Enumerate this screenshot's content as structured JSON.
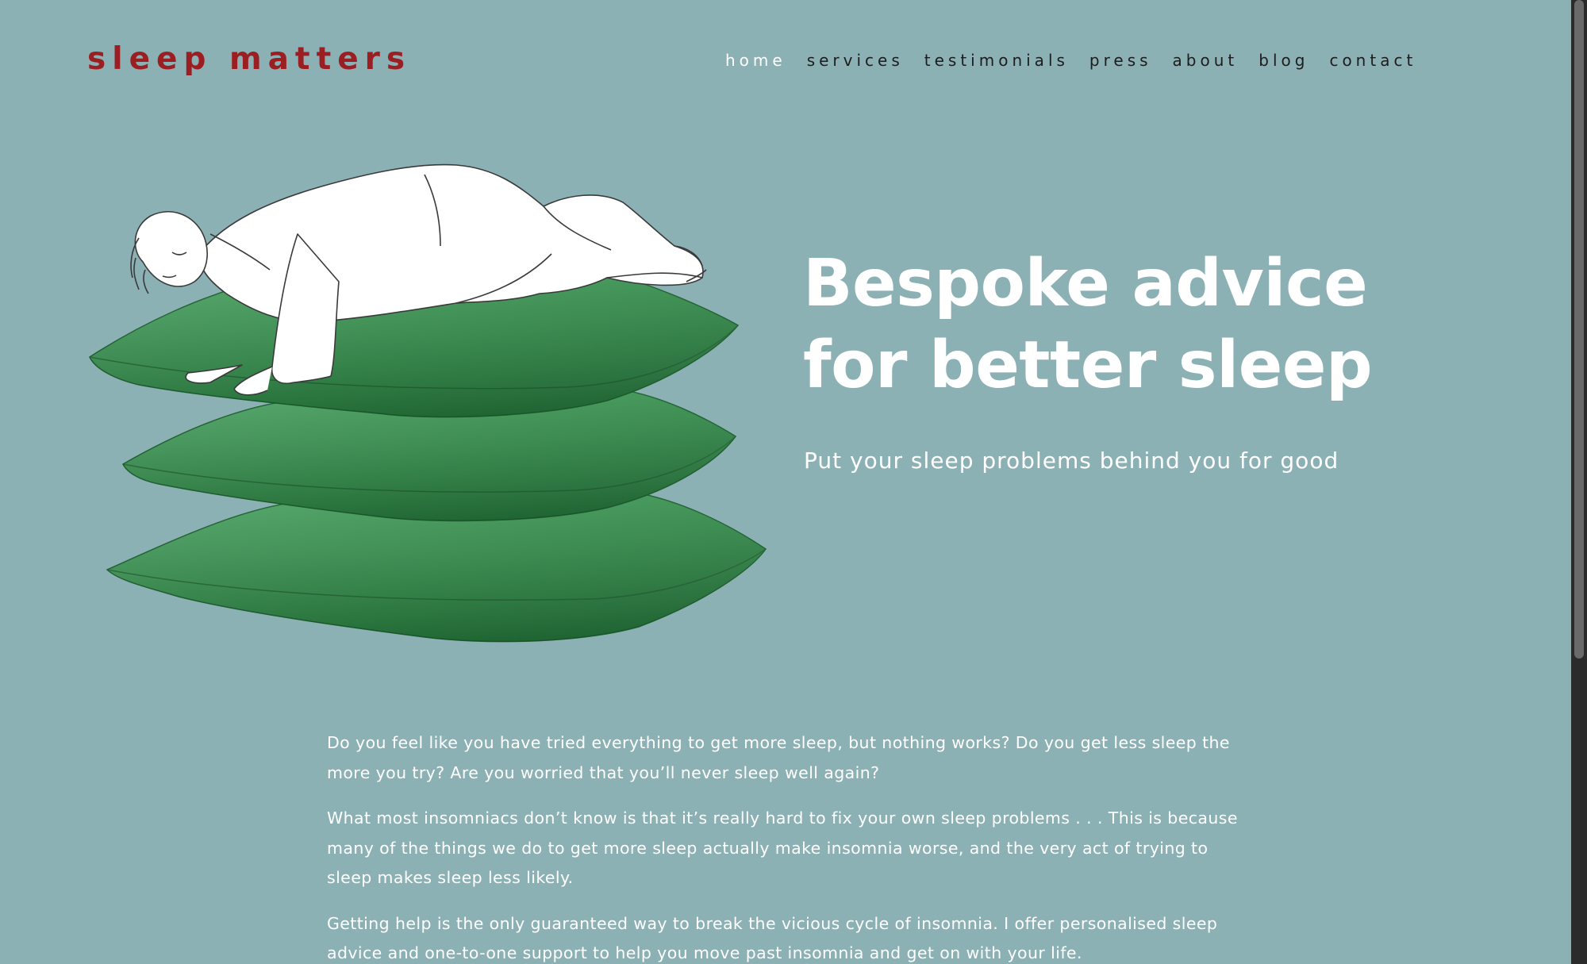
{
  "brand": {
    "logo_text": "sleep matters",
    "logo_color": "#9b1f22",
    "background_color": "#8cb1b5"
  },
  "nav": {
    "items": [
      {
        "label": "home",
        "active": true
      },
      {
        "label": "services"
      },
      {
        "label": "testimonials"
      },
      {
        "label": "press"
      },
      {
        "label": "about"
      },
      {
        "label": "blog"
      },
      {
        "label": "contact"
      }
    ]
  },
  "hero": {
    "illustration": "person-sleeping-on-green-pillows",
    "title_line1": "Bespoke advice",
    "title_line2": "for better sleep",
    "subtitle": "Put your sleep problems behind you for good"
  },
  "intro": {
    "paragraphs": [
      "Do you feel like you have tried everything to get more sleep, but nothing works? Do you get less sleep the more you try? Are you worried that you’ll never sleep well again?",
      "What most insomniacs don’t know is that it’s really hard to fix your own sleep problems . . . This is because many of the things we do to get more sleep actually make insomnia worse, and the very act of trying to sleep makes sleep less likely.",
      "Getting help is the only guaranteed way to break the vicious cycle of insomnia. I offer personalised sleep advice and one-to-one support to help you move past insomnia and get on with your life."
    ]
  }
}
